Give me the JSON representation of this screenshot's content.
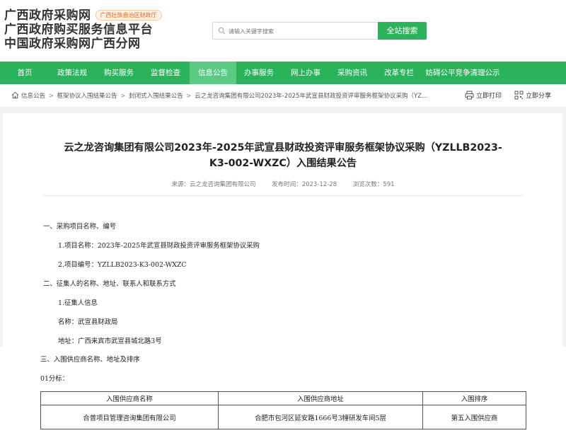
{
  "header": {
    "logo_lines": [
      "广西政府采购网",
      "广西政府购买服务信息平台",
      "中国政府采购网广西分网"
    ],
    "logo_tag": "广西壮族自治区财政厅",
    "search_placeholder": "请输入关键字搜索",
    "search_button": "全站搜索"
  },
  "nav": {
    "items": [
      "首页",
      "政策法规",
      "购买服务",
      "监督检查",
      "信息公告",
      "办事服务",
      "网上办事",
      "采购资讯",
      "改革专栏",
      "妨碍公平竞争清理公示"
    ],
    "active": "信息公告"
  },
  "breadcrumb": {
    "items": [
      "信息公告",
      "框架协议入围结果公告",
      "封闭式入围结果公告",
      "云之龙咨询集团有限公司2023年-2025年武宣县财政投资评审服务框架协议采购（YZ..."
    ],
    "print_label": "立即打印",
    "share_label": "立即分享"
  },
  "article": {
    "title_line1": "云之龙咨询集团有限公司2023年-2025年武宣县财政投资评审服务框架协议采购（YZLLB2023-",
    "title_line2": "K3-002-WXZC）入围结果公告",
    "source": "来源：云之龙咨询集团有限公司",
    "publish_time": "发布时间：2023-12-28",
    "views": "浏览次数：591",
    "paragraphs": {
      "s1": "一、采购项目名称、编号",
      "p1": "1.项目名称：2023年-2025年武宣县财政投资评审服务框架协议采购",
      "p2": "2.项目编号：YZLLB2023-K3-002-WXZC",
      "s2": "二、征集人的名称、地址、联系人和联系方式",
      "p3": "1.征集人信息",
      "p4": "名称：武宣县财政局",
      "p5": "地址：广西来宾市武宣县城北路3号",
      "s3": "三、入围供应商名称、地址及排序",
      "p6": "01分标："
    },
    "table": {
      "headers": [
        "入围供应商名称",
        "入围供应商地址",
        "入围排序"
      ],
      "rows": [
        [
          "合普项目管理咨询集团有限公司",
          "合肥市包河区延安路1666号3幢研发车间5层",
          "第五入围供应商"
        ]
      ]
    }
  },
  "colors": {
    "brand_green": "#2bb35c",
    "active_nav": "#5cc985",
    "tag_orange": "#e0602a"
  }
}
